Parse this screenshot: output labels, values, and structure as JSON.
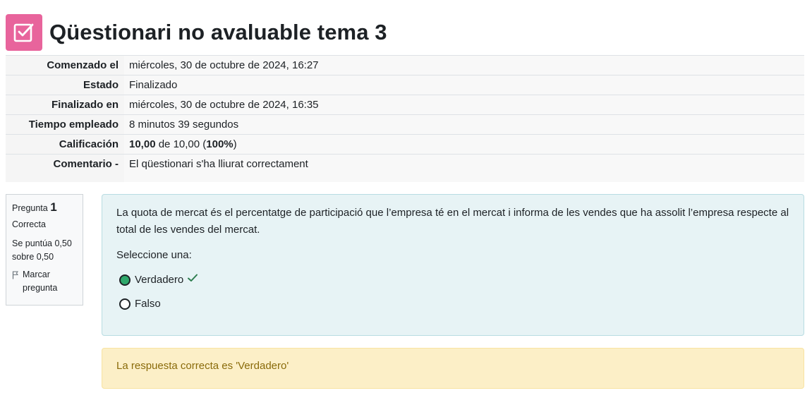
{
  "header": {
    "title": "Qüestionari no avaluable tema 3",
    "icon": "quiz-checkbox-icon",
    "icon_color": "#e8649c"
  },
  "summary": [
    {
      "label": "Comenzado el",
      "value": "miércoles, 30 de octubre de 2024, 16:27"
    },
    {
      "label": "Estado",
      "value": "Finalizado"
    },
    {
      "label": "Finalizado en",
      "value": "miércoles, 30 de octubre de 2024, 16:35"
    },
    {
      "label": "Tiempo empleado",
      "value": "8 minutos 39 segundos"
    },
    {
      "label": "Calificación",
      "value_bold": "10,00",
      "value_mid": " de 10,00 (",
      "value_pct": "100%",
      "value_end": ")"
    },
    {
      "label": "Comentario -",
      "value": "El qüestionari s'ha lliurat correctament"
    }
  ],
  "question": {
    "label": "Pregunta",
    "number": "1",
    "state": "Correcta",
    "grade": "Se puntúa 0,50 sobre 0,50",
    "flag_label": "Marcar pregunta",
    "text": "La quota de mercat és el percentatge de participació que l’empresa té en el mercat i informa de les vendes que ha assolit l’empresa respecte al total de les vendes del mercat.",
    "prompt": "Seleccione una:",
    "options": [
      {
        "label": "Verdadero",
        "selected": true,
        "correct": true
      },
      {
        "label": "Falso",
        "selected": false,
        "correct": false
      }
    ],
    "feedback": "La respuesta correcta es 'Verdadero'"
  },
  "colors": {
    "accent_selected": "#2ea86b",
    "formulation_bg": "#e7f3f5",
    "feedback_bg": "#fcefc7",
    "feedback_text": "#8a6b0a"
  }
}
